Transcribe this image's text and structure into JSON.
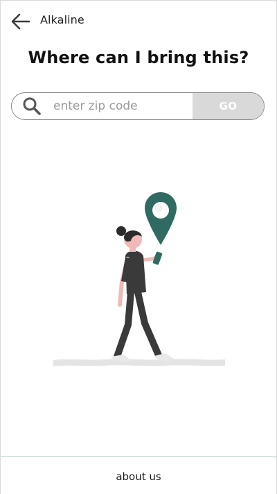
{
  "header": {
    "back_icon": "arrow-left-icon",
    "title": "Alkaline"
  },
  "main": {
    "title": "Where can I bring this?",
    "search": {
      "icon": "search-icon",
      "value": "",
      "placeholder": "enter zip code",
      "button_label": "GO"
    },
    "illustration": {
      "subject": "woman-walking-with-phone-and-location-pin-illustration"
    }
  },
  "footer": {
    "about_label": "about us"
  },
  "colors": {
    "accent": "#2f6b63",
    "go_button_bg": "#d9d9d9",
    "footer_border": "#b8cfc8"
  }
}
